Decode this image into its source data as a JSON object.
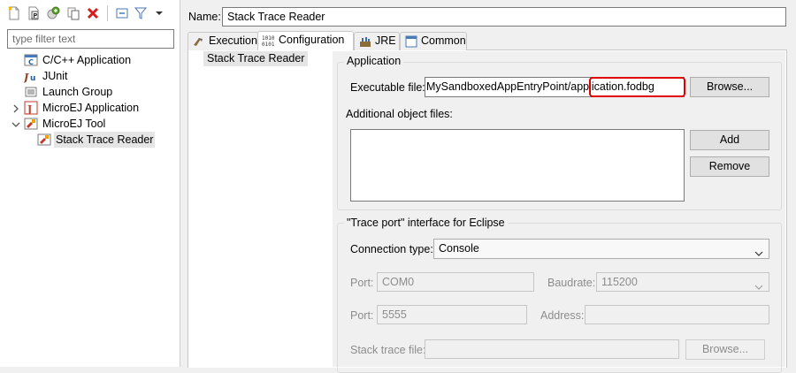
{
  "sidebar": {
    "filter_placeholder": "type filter text",
    "tree": [
      {
        "label": "C/C++ Application",
        "icon": "c-application-icon"
      },
      {
        "label": "JUnit",
        "icon": "junit-icon"
      },
      {
        "label": "Launch Group",
        "icon": "launch-group-icon"
      },
      {
        "label": "MicroEJ Application",
        "icon": "microej-application-icon",
        "expanded": false
      },
      {
        "label": "MicroEJ Tool",
        "icon": "microej-tool-icon",
        "expanded": true
      },
      {
        "label": "Stack Trace Reader",
        "icon": "stack-trace-reader-icon",
        "selected": true
      }
    ]
  },
  "config": {
    "name_label": "Name:",
    "name_value": "Stack Trace Reader",
    "tabs": [
      {
        "label": "Execution",
        "icon": "execution-icon"
      },
      {
        "label": "Configuration",
        "icon": "binary-icon",
        "active": true
      },
      {
        "label": "JRE",
        "icon": "jre-icon"
      },
      {
        "label": "Common",
        "icon": "common-icon"
      }
    ],
    "nav_item": "Stack Trace Reader",
    "application": {
      "group_label": "Application",
      "executable_label": "Executable file:",
      "executable_value": "rated.MySandboxedAppEntryPoint/application.fodbg",
      "browse_label": "Browse...",
      "additional_label": "Additional object files:",
      "add_label": "Add",
      "remove_label": "Remove"
    },
    "trace_port": {
      "group_label": "\"Trace port\" interface for Eclipse",
      "connection_label": "Connection type:",
      "connection_value": "Console",
      "port_label": "Port:",
      "port_serial_value": "COM0",
      "baudrate_label": "Baudrate:",
      "baudrate_value": "115200",
      "port_socket_value": "5555",
      "address_label": "Address:",
      "address_value": "",
      "stack_trace_label": "Stack trace file:",
      "stack_trace_value": "",
      "browse_label": "Browse..."
    },
    "highlight_color": "#e00000"
  }
}
